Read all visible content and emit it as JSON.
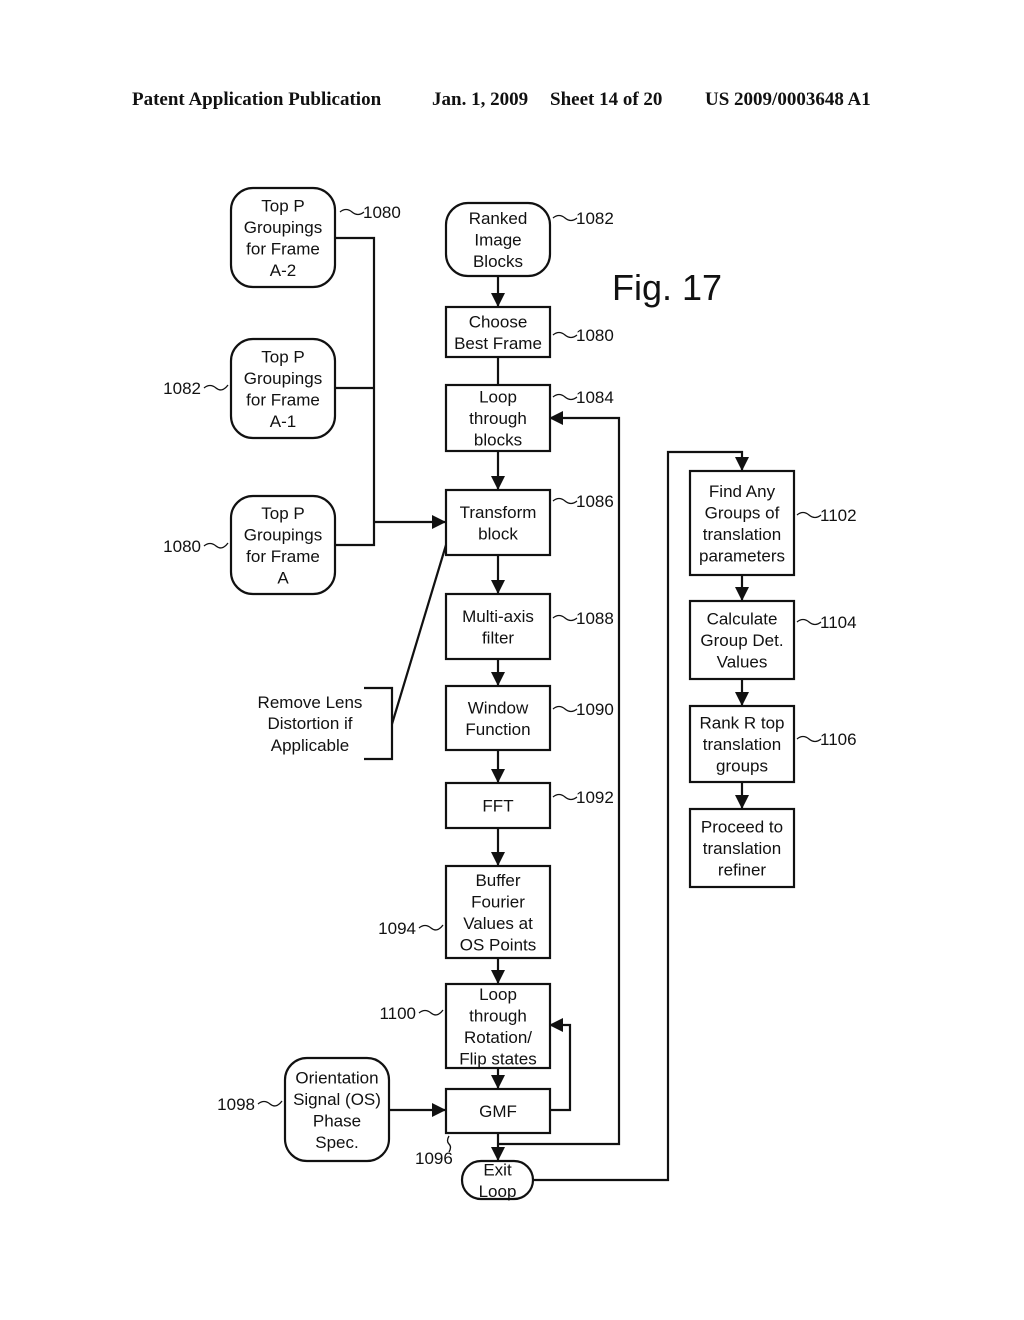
{
  "header": {
    "publication": "Patent Application Publication",
    "date": "Jan. 1, 2009",
    "sheet": "Sheet 14 of 20",
    "number": "US 2009/0003648 A1"
  },
  "figure_label": "Fig. 17",
  "nodes": {
    "top_p_a2": {
      "lines": [
        "Top P",
        "Groupings",
        "for Frame",
        "A-2"
      ],
      "ref": "1080"
    },
    "top_p_a1": {
      "lines": [
        "Top P",
        "Groupings",
        "for Frame",
        "A-1"
      ],
      "ref": "1082"
    },
    "top_p_a": {
      "lines": [
        "Top P",
        "Groupings",
        "for Frame",
        "A"
      ],
      "ref": "1080"
    },
    "ranked": {
      "lines": [
        "Ranked",
        "Image",
        "Blocks"
      ],
      "ref": "1082"
    },
    "choose": {
      "lines": [
        "Choose",
        "Best Frame"
      ],
      "ref": "1080"
    },
    "loop_blocks": {
      "lines": [
        "Loop",
        "through",
        "blocks"
      ],
      "ref": "1084"
    },
    "transform": {
      "lines": [
        "Transform",
        "block"
      ],
      "ref": "1086"
    },
    "multiaxis": {
      "lines": [
        "Multi-axis",
        "filter"
      ],
      "ref": "1088"
    },
    "window": {
      "lines": [
        "Window",
        "Function"
      ],
      "ref": "1090"
    },
    "fft": {
      "lines": [
        "FFT"
      ],
      "ref": "1092"
    },
    "buffer": {
      "lines": [
        "Buffer",
        "Fourier",
        "Values at",
        "OS Points"
      ],
      "ref": "1094"
    },
    "loop_rot": {
      "lines": [
        "Loop",
        "through",
        "Rotation/",
        "Flip states"
      ],
      "ref": "1100"
    },
    "gmf": {
      "lines": [
        "GMF"
      ],
      "ref": "1096"
    },
    "orient": {
      "lines": [
        "Orientation",
        "Signal (OS)",
        "Phase",
        "Spec."
      ],
      "ref": "1098"
    },
    "exit": {
      "lines": [
        "Exit",
        "Loop"
      ]
    },
    "find": {
      "lines": [
        "Find Any",
        "Groups of",
        "translation",
        "parameters"
      ],
      "ref": "1102"
    },
    "calc": {
      "lines": [
        "Calculate",
        "Group Det.",
        "Values"
      ],
      "ref": "1104"
    },
    "rank": {
      "lines": [
        "Rank R top",
        "translation",
        "groups"
      ],
      "ref": "1106"
    },
    "proceed": {
      "lines": [
        "Proceed to",
        "translation",
        "refiner"
      ]
    }
  },
  "annotation": {
    "lines": [
      "Remove Lens",
      "Distortion if",
      "Applicable"
    ]
  }
}
